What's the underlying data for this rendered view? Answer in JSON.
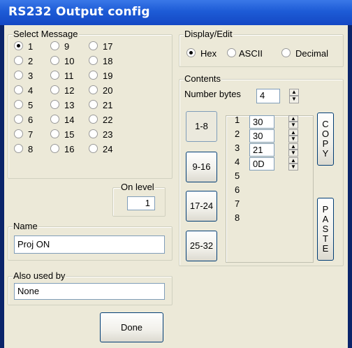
{
  "window": {
    "title": "RS232 Output config"
  },
  "select_message": {
    "label": "Select Message",
    "selected": "1",
    "col1": [
      "1",
      "2",
      "3",
      "4",
      "5",
      "6",
      "7",
      "8"
    ],
    "col2": [
      "9",
      "10",
      "11",
      "12",
      "13",
      "14",
      "15",
      "16"
    ],
    "col3": [
      "17",
      "18",
      "19",
      "20",
      "21",
      "22",
      "23",
      "24"
    ]
  },
  "display_edit": {
    "label": "Display/Edit",
    "options": [
      "Hex",
      "ASCII",
      "Decimal"
    ],
    "selected": "Hex"
  },
  "contents": {
    "label": "Contents",
    "number_bytes_label": "Number bytes",
    "number_bytes_value": "4",
    "range_buttons": [
      "1-8",
      "9-16",
      "17-24",
      "25-32"
    ],
    "selected_range": "1-8",
    "byte_labels": [
      "1",
      "2",
      "3",
      "4",
      "5",
      "6",
      "7",
      "8"
    ],
    "byte_values": [
      "30",
      "30",
      "21",
      "0D"
    ],
    "copy_letters": [
      "C",
      "O",
      "P",
      "Y"
    ],
    "paste_letters": [
      "P",
      "A",
      "S",
      "T",
      "E"
    ]
  },
  "on_level": {
    "label": "On level",
    "value": "1"
  },
  "name": {
    "label": "Name",
    "value": "Proj ON"
  },
  "also_used_by": {
    "label": "Also used by",
    "value": "None"
  },
  "done_button": "Done"
}
